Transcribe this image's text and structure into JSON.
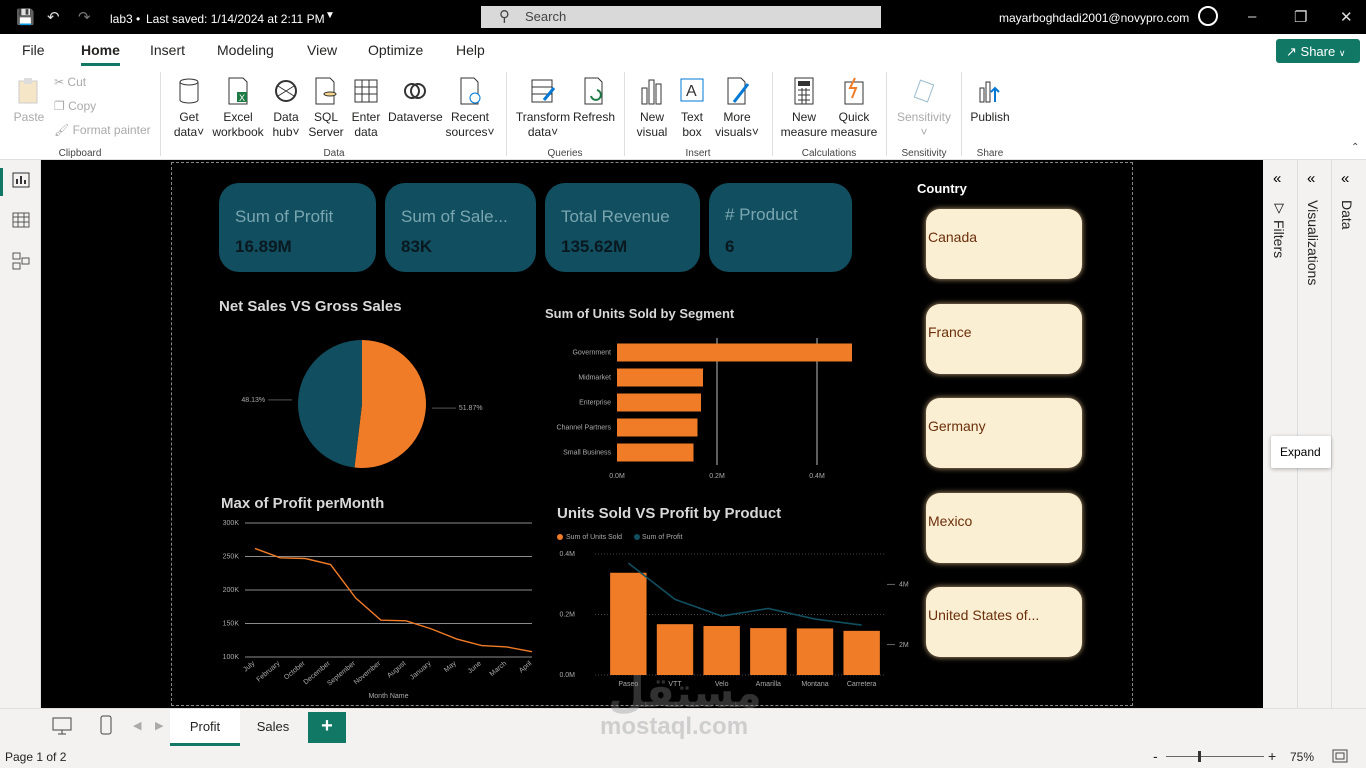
{
  "titlebar": {
    "file_title": "lab3",
    "saved": "Last saved: 1/14/2024 at 2:11 PM",
    "search_placeholder": "Search",
    "user_email": "mayarboghdadi2001@novypro.com"
  },
  "menu": {
    "file": "File",
    "home": "Home",
    "insert": "Insert",
    "modeling": "Modeling",
    "view": "View",
    "optimize": "Optimize",
    "help": "Help",
    "share": "Share"
  },
  "ribbon": {
    "paste": "Paste",
    "cut": "Cut",
    "copy": "Copy",
    "format_painter": "Format painter",
    "clipboard": "Clipboard",
    "get_data": [
      "Get",
      "data"
    ],
    "excel": [
      "Excel",
      "workbook"
    ],
    "data_hub": [
      "Data",
      "hub"
    ],
    "sql": [
      "SQL",
      "Server"
    ],
    "enter_data": [
      "Enter",
      "data"
    ],
    "dataverse": "Dataverse",
    "recent": [
      "Recent",
      "sources"
    ],
    "data_group": "Data",
    "transform": [
      "Transform",
      "data"
    ],
    "refresh": "Refresh",
    "queries": "Queries",
    "new_visual": [
      "New",
      "visual"
    ],
    "text_box": [
      "Text",
      "box"
    ],
    "more_visuals": [
      "More",
      "visuals"
    ],
    "insert_group": "Insert",
    "new_measure": [
      "New",
      "measure"
    ],
    "quick_measure": [
      "Quick",
      "measure"
    ],
    "calculations": "Calculations",
    "sensitivity": "Sensitivity",
    "sensitivity_group": "Sensitivity",
    "publish": "Publish",
    "share_group": "Share"
  },
  "panes": {
    "filters": "Filters",
    "visualizations": "Visualizations",
    "data": "Data",
    "expand_tooltip": "Expand"
  },
  "cards": [
    {
      "title": "Sum of Profit",
      "value": "16.89M"
    },
    {
      "title": "Sum of Sale...",
      "value": "83K"
    },
    {
      "title": "Total Revenue",
      "value": "135.62M"
    },
    {
      "title": "# Product",
      "value": "6"
    }
  ],
  "slicer": {
    "title": "Country",
    "items": [
      "Canada",
      "France",
      "Germany",
      "Mexico",
      "United States of..."
    ]
  },
  "chart_data": [
    {
      "type": "pie",
      "title": "Net Sales VS Gross Sales",
      "labels": [
        "51.87%",
        "48.13%"
      ],
      "values": [
        51.87,
        48.13
      ],
      "colors": [
        "#f07c27",
        "#114e5f"
      ]
    },
    {
      "type": "bar",
      "title": "Sum of Units Sold by Segment",
      "categories": [
        "Government",
        "Midmarket",
        "Enterprise",
        "Channel Partners",
        "Small Business"
      ],
      "values": [
        0.47,
        0.172,
        0.168,
        0.161,
        0.153
      ],
      "xticks": [
        "0.0M",
        "0.2M",
        "0.4M"
      ],
      "xlim": [
        0,
        0.5
      ],
      "color": "#f07c27"
    },
    {
      "type": "line",
      "title": "Max of Profit perMonth",
      "categories": [
        "July",
        "February",
        "October",
        "December",
        "September",
        "November",
        "August",
        "January",
        "May",
        "June",
        "March",
        "April"
      ],
      "values": [
        262,
        248,
        247,
        238,
        188,
        155,
        154,
        142,
        127,
        117,
        115,
        108
      ],
      "yticks": [
        "100K",
        "150K",
        "200K",
        "250K",
        "300K"
      ],
      "ylim": [
        100,
        300
      ],
      "xlabel": "Month Name",
      "color": "#f07c27"
    },
    {
      "type": "bar",
      "title": "Units Sold VS Profit by Product",
      "legend": [
        "Sum of Units Sold",
        "Sum of Profit"
      ],
      "categories": [
        "Paseo",
        "VTT",
        "Velo",
        "Amarilla",
        "Montana",
        "Carretera"
      ],
      "units_sold": [
        0.338,
        0.168,
        0.162,
        0.155,
        0.154,
        0.146
      ],
      "profit": [
        4.7,
        3.5,
        2.95,
        3.2,
        2.85,
        2.65
      ],
      "yticks_left": [
        "0.0M",
        "0.2M",
        "0.4M"
      ],
      "yticks_right": [
        "2M",
        "4M"
      ],
      "colors": [
        "#f07c27",
        "#114e5f"
      ]
    }
  ],
  "tabs": {
    "profit": "Profit",
    "sales": "Sales",
    "add": "+"
  },
  "status": {
    "page": "Page 1 of 2",
    "zoom": "75%"
  },
  "watermark": {
    "arabic": "مستقل",
    "latin": "mostaql.com"
  }
}
